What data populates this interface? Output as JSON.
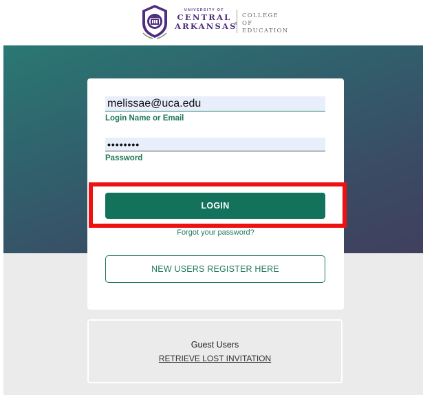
{
  "header": {
    "logo": {
      "university_prefix": "UNIVERSITY OF",
      "line1": "CENTRAL",
      "line2": "ARKANSAS",
      "trademark": "®",
      "college_line1": "COLLEGE OF",
      "college_line2": "EDUCATION"
    }
  },
  "login_form": {
    "email": {
      "value": "melissae@uca.edu",
      "label": "Login Name or Email"
    },
    "password": {
      "value": "••••••••",
      "label": "Password"
    },
    "login_button": "LOGIN",
    "forgot_password": "Forgot your password?",
    "register_button": "NEW USERS REGISTER HERE"
  },
  "guest": {
    "title": "Guest Users",
    "retrieve_link": "RETRIEVE LOST INVITATION"
  },
  "colors": {
    "brand_green": "#13725c",
    "brand_purple": "#4f2d7f",
    "highlight_red": "#ee1111"
  },
  "icons": {
    "seal": "university-seal-icon"
  }
}
